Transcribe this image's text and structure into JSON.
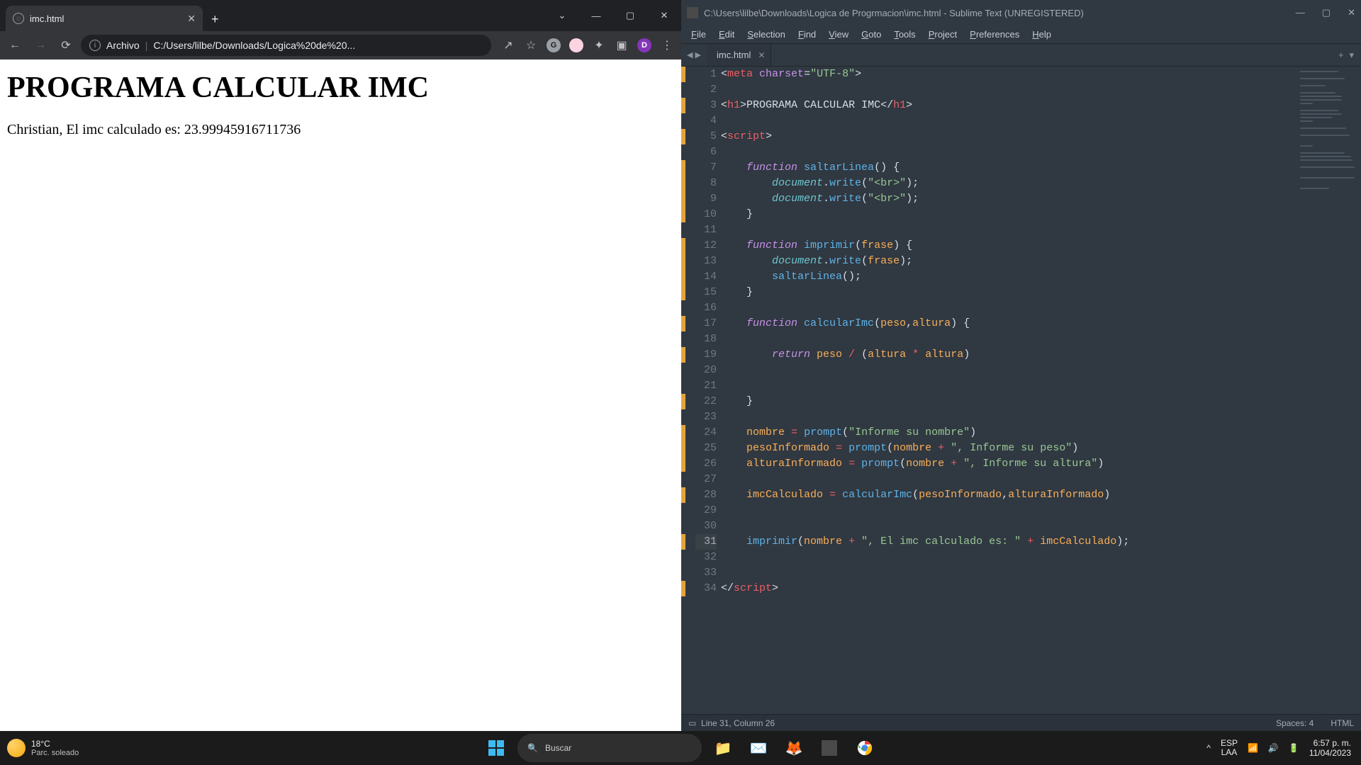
{
  "browser": {
    "tab_title": "imc.html",
    "omnibox_prefix": "Archivo",
    "omnibox_path": "C:/Users/lilbe/Downloads/Logica%20de%20...",
    "profile_letter": "D",
    "page_heading": "PROGRAMA CALCULAR IMC",
    "page_text": "Christian, El imc calculado es: 23.99945916711736"
  },
  "sublime": {
    "window_title": "C:\\Users\\lilbe\\Downloads\\Logica de Progrmacion\\imc.html - Sublime Text (UNREGISTERED)",
    "menu": [
      "File",
      "Edit",
      "Selection",
      "Find",
      "View",
      "Goto",
      "Tools",
      "Project",
      "Preferences",
      "Help"
    ],
    "tab_title": "imc.html",
    "status_left": "Line 31, Column 26",
    "status_spaces": "Spaces: 4",
    "status_lang": "HTML",
    "modified_lines": [
      1,
      3,
      5,
      7,
      8,
      9,
      10,
      12,
      13,
      14,
      15,
      17,
      19,
      22,
      24,
      25,
      26,
      28,
      31,
      34
    ],
    "highlighted_line": 31,
    "code": {
      "l1": [
        "<",
        "meta",
        " ",
        "charset",
        "=",
        "\"UTF-8\"",
        ">"
      ],
      "l3": [
        "<",
        "h1",
        ">",
        "PROGRAMA CALCULAR IMC",
        "</",
        "h1",
        ">"
      ],
      "l5": [
        "<",
        "script",
        ">"
      ],
      "l7": [
        "    ",
        "function",
        " ",
        "saltarLinea",
        "()",
        " {"
      ],
      "l8": [
        "        ",
        "document",
        ".",
        "write",
        "(",
        "\"<br>\"",
        ");"
      ],
      "l9": [
        "        ",
        "document",
        ".",
        "write",
        "(",
        "\"<br>\"",
        ");"
      ],
      "l10": [
        "    ",
        "}"
      ],
      "l12": [
        "    ",
        "function",
        " ",
        "imprimir",
        "(",
        "frase",
        ")",
        " {"
      ],
      "l13": [
        "        ",
        "document",
        ".",
        "write",
        "(",
        "frase",
        ");"
      ],
      "l14": [
        "        ",
        "saltarLinea",
        "();"
      ],
      "l15": [
        "    ",
        "}"
      ],
      "l17": [
        "    ",
        "function",
        " ",
        "calcularImc",
        "(",
        "peso",
        ",",
        "altura",
        ")",
        " {"
      ],
      "l19": [
        "        ",
        "return",
        " ",
        "peso",
        " / (",
        "altura",
        " * ",
        "altura",
        ")"
      ],
      "l22": [
        "    ",
        "}"
      ],
      "l24": [
        "    ",
        "nombre",
        " = ",
        "prompt",
        "(",
        "\"Informe su nombre\"",
        ")"
      ],
      "l25": [
        "    ",
        "pesoInformado",
        " = ",
        "prompt",
        "(",
        "nombre",
        " + ",
        "\", Informe su peso\"",
        ")"
      ],
      "l26": [
        "    ",
        "alturaInformado",
        " = ",
        "prompt",
        "(",
        "nombre",
        " + ",
        "\", Informe su altura\"",
        ")"
      ],
      "l28": [
        "    ",
        "imcCalculado",
        " = ",
        "calcularImc",
        "(",
        "pesoInformado",
        ",",
        "alturaInformado",
        ")"
      ],
      "l31": [
        "    ",
        "imprimir",
        "(",
        "nombre",
        " + ",
        "\", El imc calculado es: \"",
        " + ",
        "imcCalculado",
        ");"
      ],
      "l34": [
        "</",
        "script",
        ">"
      ]
    }
  },
  "taskbar": {
    "temp": "18°C",
    "weather_desc": "Parc. soleado",
    "search_placeholder": "Buscar",
    "lang1": "ESP",
    "lang2": "LAA",
    "time": "6:57 p. m.",
    "date": "11/04/2023"
  }
}
